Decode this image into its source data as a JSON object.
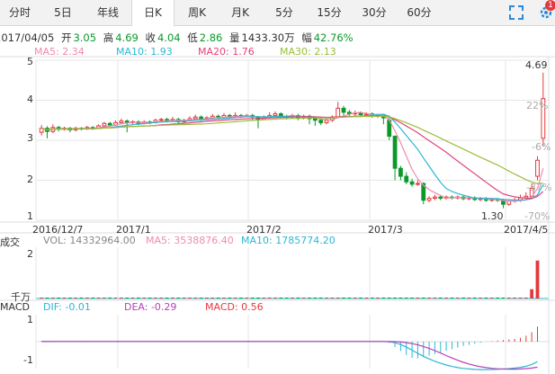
{
  "tabs": [
    {
      "label": "分时",
      "active": false
    },
    {
      "label": "5日",
      "active": false
    },
    {
      "label": "年线",
      "active": false
    },
    {
      "label": "日K",
      "active": true
    },
    {
      "label": "周K",
      "active": false
    },
    {
      "label": "月K",
      "active": false
    },
    {
      "label": "5分",
      "active": false
    },
    {
      "label": "15分",
      "active": false
    },
    {
      "label": "30分",
      "active": false
    },
    {
      "label": "60分",
      "active": false
    }
  ],
  "toolbar": {
    "expand_icon": "fullscreen-icon",
    "settings_icon": "gear-icon",
    "badge": "1"
  },
  "quote": {
    "date": "2017/04/05",
    "open_label": "开",
    "open": "3.05",
    "high_label": "高",
    "high": "4.69",
    "close_label": "收",
    "close": "4.04",
    "low_label": "低",
    "low": "2.86",
    "volume_label": "量",
    "volume": "1433.30万",
    "amplitude_label": "幅",
    "amplitude": "42.76%"
  },
  "ma": {
    "ma5": "MA5: 2.34",
    "ma10": "MA10: 1.93",
    "ma20": "MA20: 1.76",
    "ma30": "MA30: 2.13"
  },
  "price_panel": {
    "y_ticks": [
      "5",
      "4",
      "3",
      "2",
      "1"
    ],
    "right_labels": [
      "22%",
      "-6%",
      "-37%",
      "-70%"
    ],
    "high_marker": "4.69",
    "low_marker": "1.30",
    "x_ticks": [
      "2016/12/7",
      "2017/1",
      "2017/2",
      "2017/3",
      "2017/4/5"
    ]
  },
  "volume_panel": {
    "title": "成交",
    "vol": "VOL: 14332964.00",
    "ma5": "MA5: 3538876.40",
    "ma10": "MA10: 1785774.20",
    "y_top": "2",
    "unit": "千万"
  },
  "macd_panel": {
    "title": "MACD",
    "dif": "DIF: -0.01",
    "dea": "DEA: -0.29",
    "macd": "MACD: 0.56",
    "y_top": "1",
    "y_bottom": "-1"
  },
  "colors": {
    "up": "#e4393c",
    "down": "#0a9a2a",
    "ma5": "#f08ab0",
    "ma10": "#2bb7d6",
    "ma20": "#e0457b",
    "ma30": "#9cbd3a",
    "grid": "#e6e6e6"
  },
  "chart_data": {
    "type": "candlestick",
    "x_labels": [
      "2016/12/7",
      "2017/1",
      "2017/2",
      "2017/3",
      "2017/4/5"
    ],
    "ylim": [
      1,
      5
    ],
    "candles": [
      {
        "o": 3.2,
        "c": 3.3,
        "h": 3.38,
        "l": 3.12
      },
      {
        "o": 3.3,
        "c": 3.22,
        "h": 3.35,
        "l": 3.05
      },
      {
        "o": 3.22,
        "c": 3.32,
        "h": 3.4,
        "l": 3.18
      },
      {
        "o": 3.32,
        "c": 3.28,
        "h": 3.36,
        "l": 3.22
      },
      {
        "o": 3.28,
        "c": 3.3,
        "h": 3.34,
        "l": 3.24
      },
      {
        "o": 3.3,
        "c": 3.26,
        "h": 3.33,
        "l": 3.2
      },
      {
        "o": 3.26,
        "c": 3.3,
        "h": 3.34,
        "l": 3.22
      },
      {
        "o": 3.3,
        "c": 3.28,
        "h": 3.33,
        "l": 3.25
      },
      {
        "o": 3.28,
        "c": 3.32,
        "h": 3.36,
        "l": 3.26
      },
      {
        "o": 3.32,
        "c": 3.3,
        "h": 3.35,
        "l": 3.26
      },
      {
        "o": 3.3,
        "c": 3.36,
        "h": 3.4,
        "l": 3.28
      },
      {
        "o": 3.36,
        "c": 3.42,
        "h": 3.46,
        "l": 3.3
      },
      {
        "o": 3.42,
        "c": 3.38,
        "h": 3.46,
        "l": 3.34
      },
      {
        "o": 3.38,
        "c": 3.44,
        "h": 3.5,
        "l": 3.36
      },
      {
        "o": 3.44,
        "c": 3.48,
        "h": 3.54,
        "l": 3.4
      },
      {
        "o": 3.48,
        "c": 3.44,
        "h": 3.52,
        "l": 3.2
      },
      {
        "o": 3.44,
        "c": 3.46,
        "h": 3.5,
        "l": 3.4
      },
      {
        "o": 3.46,
        "c": 3.42,
        "h": 3.5,
        "l": 3.38
      },
      {
        "o": 3.42,
        "c": 3.46,
        "h": 3.5,
        "l": 3.4
      },
      {
        "o": 3.46,
        "c": 3.44,
        "h": 3.5,
        "l": 3.4
      },
      {
        "o": 3.44,
        "c": 3.5,
        "h": 3.54,
        "l": 3.42
      },
      {
        "o": 3.5,
        "c": 3.52,
        "h": 3.56,
        "l": 3.46
      },
      {
        "o": 3.52,
        "c": 3.48,
        "h": 3.56,
        "l": 3.44
      },
      {
        "o": 3.48,
        "c": 3.52,
        "h": 3.58,
        "l": 3.46
      },
      {
        "o": 3.52,
        "c": 3.46,
        "h": 3.56,
        "l": 3.4
      },
      {
        "o": 3.46,
        "c": 3.5,
        "h": 3.54,
        "l": 3.42
      },
      {
        "o": 3.5,
        "c": 3.54,
        "h": 3.6,
        "l": 3.48
      },
      {
        "o": 3.54,
        "c": 3.58,
        "h": 3.64,
        "l": 3.5
      },
      {
        "o": 3.58,
        "c": 3.52,
        "h": 3.62,
        "l": 3.48
      },
      {
        "o": 3.52,
        "c": 3.56,
        "h": 3.6,
        "l": 3.5
      },
      {
        "o": 3.56,
        "c": 3.6,
        "h": 3.66,
        "l": 3.52
      },
      {
        "o": 3.6,
        "c": 3.56,
        "h": 3.64,
        "l": 3.52
      },
      {
        "o": 3.56,
        "c": 3.62,
        "h": 3.68,
        "l": 3.54
      },
      {
        "o": 3.62,
        "c": 3.58,
        "h": 3.66,
        "l": 3.54
      },
      {
        "o": 3.58,
        "c": 3.62,
        "h": 3.7,
        "l": 3.56
      },
      {
        "o": 3.62,
        "c": 3.6,
        "h": 3.66,
        "l": 3.56
      },
      {
        "o": 3.6,
        "c": 3.62,
        "h": 3.66,
        "l": 3.58
      },
      {
        "o": 3.62,
        "c": 3.58,
        "h": 3.66,
        "l": 3.5
      },
      {
        "o": 3.58,
        "c": 3.52,
        "h": 3.6,
        "l": 3.3
      },
      {
        "o": 3.52,
        "c": 3.56,
        "h": 3.62,
        "l": 3.5
      },
      {
        "o": 3.56,
        "c": 3.62,
        "h": 3.7,
        "l": 3.54
      },
      {
        "o": 3.62,
        "c": 3.66,
        "h": 3.72,
        "l": 3.6
      },
      {
        "o": 3.66,
        "c": 3.6,
        "h": 3.7,
        "l": 3.56
      },
      {
        "o": 3.6,
        "c": 3.58,
        "h": 3.64,
        "l": 3.52
      },
      {
        "o": 3.58,
        "c": 3.62,
        "h": 3.66,
        "l": 3.54
      },
      {
        "o": 3.62,
        "c": 3.56,
        "h": 3.66,
        "l": 3.5
      },
      {
        "o": 3.56,
        "c": 3.6,
        "h": 3.64,
        "l": 3.52
      },
      {
        "o": 3.6,
        "c": 3.54,
        "h": 3.64,
        "l": 3.4
      },
      {
        "o": 3.54,
        "c": 3.5,
        "h": 3.58,
        "l": 3.36
      },
      {
        "o": 3.5,
        "c": 3.44,
        "h": 3.56,
        "l": 3.38
      },
      {
        "o": 3.44,
        "c": 3.5,
        "h": 3.54,
        "l": 3.4
      },
      {
        "o": 3.5,
        "c": 3.58,
        "h": 3.62,
        "l": 3.46
      },
      {
        "o": 3.58,
        "c": 3.8,
        "h": 3.96,
        "l": 3.56
      },
      {
        "o": 3.8,
        "c": 3.7,
        "h": 3.86,
        "l": 3.62
      },
      {
        "o": 3.7,
        "c": 3.66,
        "h": 3.76,
        "l": 3.58
      },
      {
        "o": 3.66,
        "c": 3.68,
        "h": 3.74,
        "l": 3.6
      },
      {
        "o": 3.68,
        "c": 3.64,
        "h": 3.72,
        "l": 3.58
      },
      {
        "o": 3.64,
        "c": 3.66,
        "h": 3.7,
        "l": 3.6
      },
      {
        "o": 3.66,
        "c": 3.6,
        "h": 3.7,
        "l": 3.56
      },
      {
        "o": 3.6,
        "c": 3.62,
        "h": 3.66,
        "l": 3.56
      },
      {
        "o": 3.62,
        "c": 3.56,
        "h": 3.66,
        "l": 3.4
      },
      {
        "o": 3.5,
        "c": 3.1,
        "h": 3.56,
        "l": 3.0
      },
      {
        "o": 3.1,
        "c": 2.3,
        "h": 3.12,
        "l": 2.0
      },
      {
        "o": 2.3,
        "c": 2.1,
        "h": 2.36,
        "l": 2.0
      },
      {
        "o": 2.1,
        "c": 1.96,
        "h": 2.2,
        "l": 1.9
      },
      {
        "o": 1.96,
        "c": 1.9,
        "h": 2.04,
        "l": 1.84
      },
      {
        "o": 1.9,
        "c": 1.92,
        "h": 2.0,
        "l": 1.86
      },
      {
        "o": 1.92,
        "c": 1.5,
        "h": 1.95,
        "l": 1.4
      },
      {
        "o": 1.5,
        "c": 1.55,
        "h": 1.6,
        "l": 1.45
      },
      {
        "o": 1.55,
        "c": 1.58,
        "h": 1.64,
        "l": 1.5
      },
      {
        "o": 1.58,
        "c": 1.55,
        "h": 1.62,
        "l": 1.5
      },
      {
        "o": 1.55,
        "c": 1.58,
        "h": 1.62,
        "l": 1.52
      },
      {
        "o": 1.58,
        "c": 1.56,
        "h": 1.62,
        "l": 1.52
      },
      {
        "o": 1.56,
        "c": 1.58,
        "h": 1.62,
        "l": 1.52
      },
      {
        "o": 1.58,
        "c": 1.54,
        "h": 1.62,
        "l": 1.5
      },
      {
        "o": 1.54,
        "c": 1.56,
        "h": 1.6,
        "l": 1.5
      },
      {
        "o": 1.56,
        "c": 1.52,
        "h": 1.6,
        "l": 1.48
      },
      {
        "o": 1.52,
        "c": 1.54,
        "h": 1.58,
        "l": 1.48
      },
      {
        "o": 1.54,
        "c": 1.5,
        "h": 1.58,
        "l": 1.46
      },
      {
        "o": 1.5,
        "c": 1.52,
        "h": 1.56,
        "l": 1.46
      },
      {
        "o": 1.52,
        "c": 1.5,
        "h": 1.56,
        "l": 1.46
      },
      {
        "o": 1.5,
        "c": 1.4,
        "h": 1.54,
        "l": 1.3
      },
      {
        "o": 1.4,
        "c": 1.48,
        "h": 1.52,
        "l": 1.36
      },
      {
        "o": 1.48,
        "c": 1.5,
        "h": 1.56,
        "l": 1.44
      },
      {
        "o": 1.5,
        "c": 1.56,
        "h": 1.64,
        "l": 1.46
      },
      {
        "o": 1.56,
        "c": 1.6,
        "h": 1.7,
        "l": 1.52
      },
      {
        "o": 1.6,
        "c": 1.8,
        "h": 1.9,
        "l": 1.56
      },
      {
        "o": 2.1,
        "c": 2.5,
        "h": 2.6,
        "l": 2.0
      },
      {
        "o": 3.05,
        "c": 4.04,
        "h": 4.69,
        "l": 2.86
      }
    ],
    "volume": [
      0.02,
      0.02,
      0.02,
      0.02,
      0.02,
      0.02,
      0.02,
      0.02,
      0.02,
      0.02,
      0.02,
      0.02,
      0.02,
      0.02,
      0.02,
      0.02,
      0.02,
      0.02,
      0.02,
      0.02,
      0.02,
      0.02,
      0.02,
      0.02,
      0.02,
      0.02,
      0.02,
      0.02,
      0.02,
      0.02,
      0.02,
      0.02,
      0.02,
      0.02,
      0.02,
      0.02,
      0.02,
      0.02,
      0.02,
      0.02,
      0.02,
      0.02,
      0.02,
      0.02,
      0.02,
      0.02,
      0.02,
      0.02,
      0.02,
      0.02,
      0.02,
      0.02,
      0.02,
      0.02,
      0.02,
      0.02,
      0.02,
      0.02,
      0.02,
      0.02,
      0.02,
      0.02,
      0.02,
      0.02,
      0.02,
      0.02,
      0.02,
      0.02,
      0.02,
      0.02,
      0.02,
      0.02,
      0.02,
      0.02,
      0.02,
      0.02,
      0.02,
      0.02,
      0.02,
      0.02,
      0.02,
      0.02,
      0.02,
      0.02,
      0.02,
      0.03,
      0.35,
      1.43
    ],
    "macd_hist": [
      0.02,
      0.01,
      0.01,
      0.0,
      0.0,
      0.0,
      0.0,
      -0.01,
      0.0,
      0.0,
      0.0,
      0.0,
      0.0,
      0.0,
      0.0,
      0.0,
      0.0,
      0.0,
      0.0,
      0.0,
      0.0,
      0.0,
      0.0,
      0.0,
      0.0,
      0.0,
      0.0,
      0.0,
      0.0,
      0.0,
      0.0,
      0.0,
      0.0,
      0.0,
      0.0,
      0.0,
      0.0,
      0.0,
      0.0,
      0.0,
      0.0,
      0.0,
      0.0,
      0.0,
      0.0,
      0.0,
      0.0,
      0.0,
      0.0,
      0.0,
      0.0,
      0.0,
      0.0,
      0.0,
      0.0,
      0.0,
      0.0,
      0.0,
      0.0,
      0.0,
      0.0,
      -0.05,
      -0.2,
      -0.35,
      -0.5,
      -0.6,
      -0.62,
      -0.58,
      -0.52,
      -0.46,
      -0.4,
      -0.34,
      -0.28,
      -0.22,
      -0.16,
      -0.12,
      -0.08,
      -0.04,
      0.0,
      0.02,
      0.04,
      0.06,
      0.08,
      0.1,
      0.14,
      0.22,
      0.35,
      0.56
    ]
  }
}
